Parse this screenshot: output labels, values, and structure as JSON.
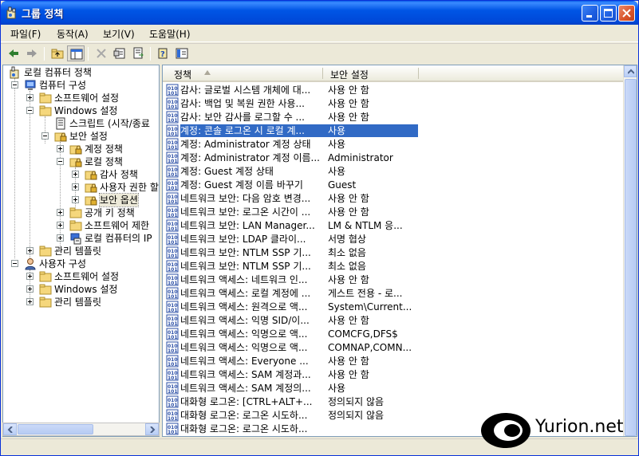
{
  "window": {
    "title": "그룹 정책",
    "colors": {
      "titlebar": "#0055E5",
      "selection": "#316AC5",
      "frame": "#ECE9D8"
    }
  },
  "menu": [
    "파일(F)",
    "동작(A)",
    "보기(V)",
    "도움말(H)"
  ],
  "toolbar": {
    "buttons": [
      "back-icon",
      "forward-icon",
      "up-folder-icon",
      "show-tree-icon",
      "delete-icon",
      "properties-icon",
      "export-icon",
      "help-icon",
      "console-tree-icon"
    ]
  },
  "tree": {
    "items": [
      {
        "label": "로컬 컴퓨터 정책"
      },
      {
        "label": "컴퓨터 구성"
      },
      {
        "label": "소프트웨어 설정"
      },
      {
        "label": "Windows 설정"
      },
      {
        "label": "스크립트 (시작/종료"
      },
      {
        "label": "보안 설정"
      },
      {
        "label": "계정 정책"
      },
      {
        "label": "로컬 정책"
      },
      {
        "label": "감사 정책"
      },
      {
        "label": "사용자 권한 할"
      },
      {
        "label": "보안 옵션"
      },
      {
        "label": "공개 키 정책"
      },
      {
        "label": "소프트웨어 제한"
      },
      {
        "label": "로컬 컴퓨터의 IP"
      },
      {
        "label": "관리 템플릿"
      },
      {
        "label": "사용자 구성"
      },
      {
        "label": "소프트웨어 설정"
      },
      {
        "label": "Windows 설정"
      },
      {
        "label": "관리 템플릿"
      }
    ]
  },
  "list": {
    "columns": [
      "정책",
      "보안 설정"
    ],
    "rows": [
      {
        "policy": "감사: 글로벌 시스템 개체에 대...",
        "setting": "사용 안 함"
      },
      {
        "policy": "감사: 백업 및 복원 권한 사용...",
        "setting": "사용 안 함"
      },
      {
        "policy": "감사: 보안 감사를 로그할 수 ...",
        "setting": "사용 안 함"
      },
      {
        "policy": "계정: 콘솔 로그온 시 로컬 계...",
        "setting": "사용"
      },
      {
        "policy": "계정: Administrator 계정 상태",
        "setting": "사용"
      },
      {
        "policy": "계정: Administrator 계정 이름...",
        "setting": "Administrator"
      },
      {
        "policy": "계정: Guest 계정 상태",
        "setting": "사용"
      },
      {
        "policy": "계정: Guest 계정 이름 바꾸기",
        "setting": "Guest"
      },
      {
        "policy": "네트워크 보안: 다음 암호 변경...",
        "setting": "사용 안 함"
      },
      {
        "policy": "네트워크 보안: 로그온 시간이 ...",
        "setting": "사용 안 함"
      },
      {
        "policy": "네트워크 보안: LAN Manager...",
        "setting": "LM & NTLM 응..."
      },
      {
        "policy": "네트워크 보안: LDAP 클라이...",
        "setting": "서명 협상"
      },
      {
        "policy": "네트워크 보안: NTLM SSP 기...",
        "setting": "최소 없음"
      },
      {
        "policy": "네트워크 보안: NTLM SSP 기...",
        "setting": "최소 없음"
      },
      {
        "policy": "네트워크 액세스: 네트워크 인...",
        "setting": "사용 안 함"
      },
      {
        "policy": "네트워크 액세스: 로컬 계정에 ...",
        "setting": "게스트 전용 - 로..."
      },
      {
        "policy": "네트워크 액세스: 원격으로 액...",
        "setting": "System\\Current..."
      },
      {
        "policy": "네트워크 액세스: 익명 SID/이...",
        "setting": "사용 안 함"
      },
      {
        "policy": "네트워크 액세스: 익명으로 액...",
        "setting": "COMCFG,DFS$"
      },
      {
        "policy": "네트워크 액세스: 익명으로 액...",
        "setting": "COMNAP,COMN..."
      },
      {
        "policy": "네트워크 액세스: Everyone ...",
        "setting": "사용 안 함"
      },
      {
        "policy": "네트워크 액세스: SAM 계정과...",
        "setting": "사용 안 함"
      },
      {
        "policy": "네트워크 액세스: SAM 계정의...",
        "setting": "사용"
      },
      {
        "policy": "대화형 로그온: [CTRL+ALT+...",
        "setting": "정의되지 않음"
      },
      {
        "policy": "대화형 로그온: 로그온 시도하...",
        "setting": "정의되지 않음"
      },
      {
        "policy": "대화형 로그온: 로그온 시도하...",
        "setting": ""
      }
    ]
  },
  "watermark": {
    "text": "Yurion.net"
  }
}
